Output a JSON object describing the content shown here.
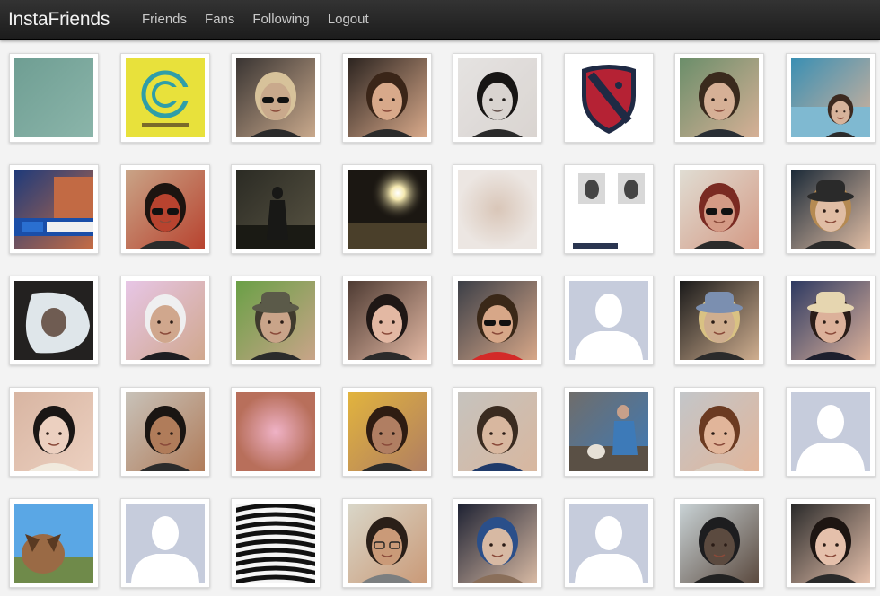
{
  "app": {
    "brand": "InstaFriends"
  },
  "nav": {
    "items": [
      "Friends",
      "Fans",
      "Following",
      "Logout"
    ]
  },
  "grid": {
    "columns": 8,
    "rows": 5,
    "tiles": [
      {
        "kind": "flat",
        "c1": "#6f9e93",
        "c2": "#8bb5aa"
      },
      {
        "kind": "logo",
        "c1": "#e8e13b",
        "c2": "#2f9ea8"
      },
      {
        "kind": "person-dark",
        "c1": "#3a3533",
        "c2": "#c9a98c",
        "hair": "#d7c29a",
        "shades": true
      },
      {
        "kind": "person",
        "c1": "#2c2420",
        "c2": "#d8a98a",
        "hair": "#3a2518"
      },
      {
        "kind": "person",
        "c1": "#e9e2dc",
        "c2": "#e4d2c6",
        "hair": "#1a1412",
        "bw": true
      },
      {
        "kind": "shield",
        "c1": "#ffffff",
        "c2": "#b52234",
        "c3": "#1f2a44"
      },
      {
        "kind": "person",
        "c1": "#6b8e6a",
        "c2": "#d6b096",
        "hair": "#3a2a1d",
        "suit": "#2a2f35"
      },
      {
        "kind": "person-small",
        "c1": "#3a8fb3",
        "c2": "#d7b39b",
        "hair": "#3d2a20"
      },
      {
        "kind": "tv",
        "c1": "#1e3a7a",
        "c2": "#c46c45"
      },
      {
        "kind": "person",
        "c1": "#c9a487",
        "c2": "#b8432f",
        "hair": "#1c1410",
        "shades": true
      },
      {
        "kind": "dark-figure",
        "c1": "#2b2b24",
        "c2": "#595443"
      },
      {
        "kind": "night-light",
        "c1": "#1d1813",
        "c2": "#f5f1d8"
      },
      {
        "kind": "blur",
        "c1": "#ece6e2",
        "c2": "#d9c6b8"
      },
      {
        "kind": "strip",
        "c1": "#ffffff",
        "c2": "#444444"
      },
      {
        "kind": "person",
        "c1": "#e0ddd3",
        "c2": "#d49a85",
        "hair": "#7a2a22",
        "shades": true
      },
      {
        "kind": "person",
        "c1": "#1b2a38",
        "c2": "#e0bda4",
        "hair": "#b58a52",
        "hat": "#2a2a2a"
      },
      {
        "kind": "car-mirror",
        "c1": "#dfe6ea",
        "c2": "#2a2725"
      },
      {
        "kind": "person",
        "c1": "#e7c6e6",
        "c2": "#d0a78d",
        "hair": "#efeff0",
        "suit": "#1e1e22"
      },
      {
        "kind": "person",
        "c1": "#6aa046",
        "c2": "#c9a489",
        "hair": "#3f3a2d",
        "hat": "#5b5a49"
      },
      {
        "kind": "person",
        "c1": "#4e3b33",
        "c2": "#e3b8a3",
        "hair": "#1f1715"
      },
      {
        "kind": "person",
        "c1": "#3c3f47",
        "c2": "#d7a788",
        "hair": "#3a2818",
        "shades": true,
        "suit": "#d32a28"
      },
      {
        "kind": "silhouette",
        "c1": "#c6ccdc",
        "c2": "#ffffff"
      },
      {
        "kind": "person",
        "c1": "#1a1a1a",
        "c2": "#cfae8f",
        "hair": "#d9c283",
        "hat": "#7b8fb0"
      },
      {
        "kind": "person",
        "c1": "#2e3a62",
        "c2": "#dcb19a",
        "hair": "#2a1d18",
        "hat": "#e6d6b0",
        "suit": "#1d1f2e"
      },
      {
        "kind": "person",
        "c1": "#d8b5a2",
        "c2": "#ecd0c0",
        "hair": "#1a1615",
        "suit": "#f1eade"
      },
      {
        "kind": "person",
        "c1": "#c8c2b9",
        "c2": "#b07c5a",
        "hair": "#1a1512"
      },
      {
        "kind": "blur",
        "c1": "#b86f5b",
        "c2": "#efb2c6"
      },
      {
        "kind": "person",
        "c1": "#e2b43d",
        "c2": "#b07e62",
        "hair": "#2e1c12"
      },
      {
        "kind": "person",
        "c1": "#c6c3be",
        "c2": "#d8b79f",
        "hair": "#3a2b20",
        "suit": "#1f3a6a"
      },
      {
        "kind": "dog-man",
        "c1": "#6f6d6b",
        "c2": "#3d7ab8"
      },
      {
        "kind": "person",
        "c1": "#c3c6c9",
        "c2": "#e1b59a",
        "hair": "#6b3a21",
        "suit": "#d8ccbf"
      },
      {
        "kind": "silhouette",
        "c1": "#c6ccdc",
        "c2": "#ffffff"
      },
      {
        "kind": "dog",
        "c1": "#5aa7e5",
        "c2": "#9a6a45"
      },
      {
        "kind": "silhouette",
        "c1": "#c6ccdc",
        "c2": "#ffffff"
      },
      {
        "kind": "stripes",
        "c1": "#111111",
        "c2": "#f5f5f5"
      },
      {
        "kind": "person",
        "c1": "#d9d7c9",
        "c2": "#ca9a78",
        "hair": "#2a1f18",
        "suit": "#7c7f80",
        "glasses": true
      },
      {
        "kind": "person",
        "c1": "#1e2233",
        "c2": "#d7b9a3",
        "hair": "#2a4f8a",
        "suit": "#8a6f5a"
      },
      {
        "kind": "silhouette",
        "c1": "#c6ccdc",
        "c2": "#ffffff"
      },
      {
        "kind": "person",
        "c1": "#c9d3d6",
        "c2": "#5b4a3f",
        "hair": "#1d1d1f",
        "suit": "#222222"
      },
      {
        "kind": "person",
        "c1": "#2a2a2a",
        "c2": "#e5c0ab",
        "hair": "#1d1512"
      }
    ]
  }
}
